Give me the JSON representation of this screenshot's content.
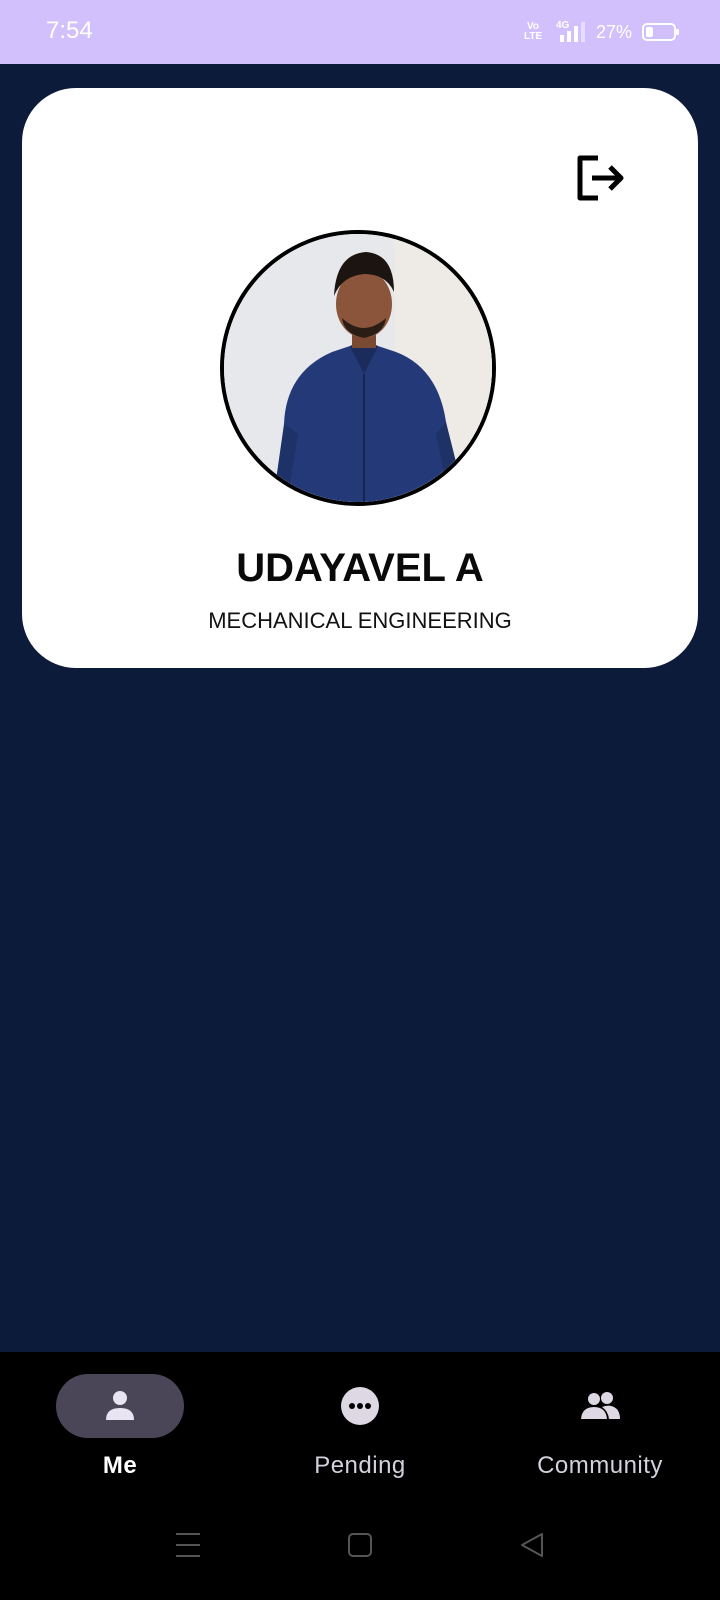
{
  "status_bar": {
    "time": "7:54",
    "volte_label": "Vo LTE",
    "network_label": "4G",
    "battery_percent_text": "27%",
    "battery_level": 0.27,
    "background_color": "#d1c0fb"
  },
  "profile": {
    "name": "UDAYAVEL A",
    "department": "MECHANICAL ENGINEERING",
    "logout_icon": "logout-icon",
    "avatar_icon": "profile-photo"
  },
  "bottom_nav": {
    "items": [
      {
        "label": "Me",
        "icon": "person-icon",
        "active": true
      },
      {
        "label": "Pending",
        "icon": "more-horizontal-circle-icon",
        "active": false
      },
      {
        "label": "Community",
        "icon": "people-icon",
        "active": false
      }
    ]
  },
  "system_nav": {
    "icons": [
      "menu-icon",
      "home-square-icon",
      "back-triangle-icon"
    ]
  },
  "colors": {
    "page_background": "#0c1b3a",
    "card_background": "#ffffff",
    "nav_background": "#000000",
    "active_pill": "#4b4657"
  }
}
